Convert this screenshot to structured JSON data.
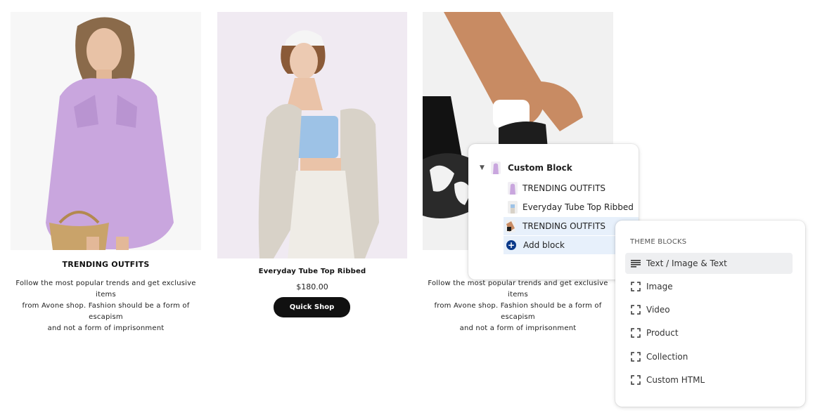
{
  "products": [
    {
      "title": "TRENDING OUTFITS",
      "description_lines": [
        "Follow the most popular trends and get exclusive items",
        "from Avone shop. Fashion should be a form of escapism",
        "and not a form of imprisonment"
      ]
    },
    {
      "title": "Everyday Tube Top Ribbed",
      "price": "$180.00",
      "button": "Quick Shop"
    },
    {
      "description_lines": [
        "Follow the most popular trends and get exclusive items",
        "from Avone shop. Fashion should be a form of escapism",
        "and not a form of imprisonment"
      ]
    }
  ],
  "tree": {
    "parent": "Custom Block",
    "children": [
      "TRENDING OUTFITS",
      "Everyday Tube Top Ribbed",
      "TRENDING OUTFITS"
    ],
    "add_block": "Add block"
  },
  "theme_blocks": {
    "heading": "THEME BLOCKS",
    "items": [
      {
        "label": "Text / Image & Text",
        "icon": "text-lines-icon"
      },
      {
        "label": "Image",
        "icon": "frame-icon"
      },
      {
        "label": "Video",
        "icon": "frame-icon"
      },
      {
        "label": "Product",
        "icon": "frame-icon"
      },
      {
        "label": "Collection",
        "icon": "frame-icon"
      },
      {
        "label": "Custom HTML",
        "icon": "frame-icon"
      }
    ]
  },
  "colors": {
    "button_bg": "#111111",
    "add_icon": "#0b3a8a",
    "selected_row": "#e7f0fb"
  }
}
